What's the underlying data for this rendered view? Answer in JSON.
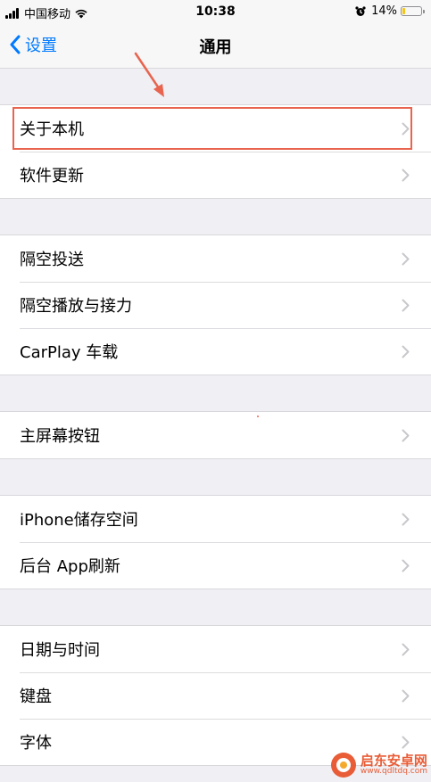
{
  "status": {
    "carrier": "中国移动",
    "time": "10:38",
    "battery": "14%",
    "battery_level": 0.14
  },
  "nav": {
    "back_label": "设置",
    "title": "通用"
  },
  "groups": [
    {
      "items": [
        "关于本机",
        "软件更新"
      ]
    },
    {
      "items": [
        "隔空投送",
        "隔空播放与接力",
        "CarPlay 车载"
      ]
    },
    {
      "items": [
        "主屏幕按钮"
      ]
    },
    {
      "items": [
        "iPhone储存空间",
        "后台 App刷新"
      ]
    },
    {
      "items": [
        "日期与时间",
        "键盘",
        "字体"
      ]
    }
  ],
  "watermark": {
    "name": "启东安卓网",
    "url": "www.qdltdq.com"
  },
  "colors": {
    "accent": "#007aff",
    "highlight": "#e8644f",
    "battery_fill": "#f5c518"
  }
}
